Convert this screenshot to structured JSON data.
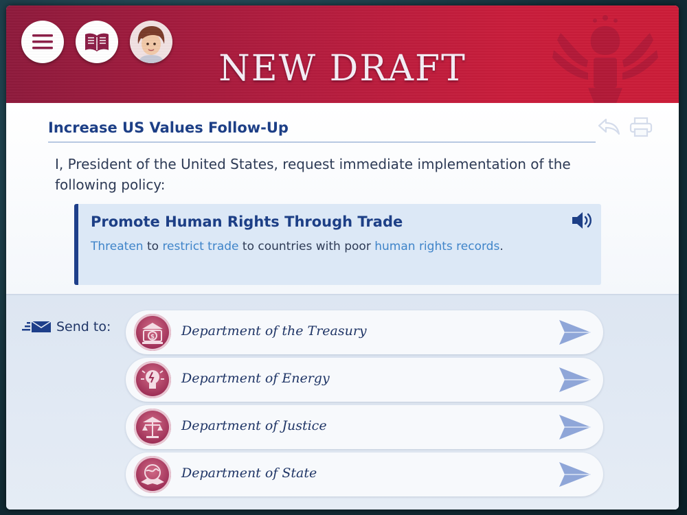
{
  "header": {
    "title": "NEW DRAFT"
  },
  "draft": {
    "subject": "Increase US Values Follow-Up",
    "intro": "I, President of the United States, request immediate implementation of the following policy:",
    "policy": {
      "title": "Promote Human Rights Through Trade",
      "text_parts": [
        "Threaten",
        " to ",
        "restrict trade",
        " to countries with poor ",
        "human rights records",
        "."
      ]
    }
  },
  "send": {
    "label": "Send to:",
    "departments": [
      {
        "name": "Department of the Treasury",
        "icon": "bank-dollar-icon"
      },
      {
        "name": "Department of Energy",
        "icon": "lightbulb-icon"
      },
      {
        "name": "Department of Justice",
        "icon": "scales-icon"
      },
      {
        "name": "Department of State",
        "icon": "handshake-globe-icon"
      }
    ]
  },
  "colors": {
    "header_red": "#c91d3b",
    "accent_blue": "#1d3f86",
    "keyword_blue": "#3f84c9",
    "department_badge": "#9c2d55",
    "send_arrow": "#8fa6d8"
  }
}
